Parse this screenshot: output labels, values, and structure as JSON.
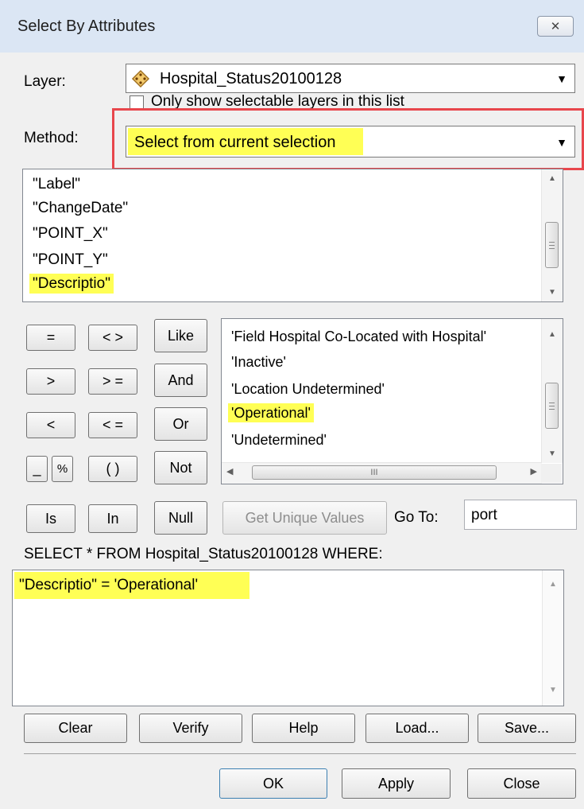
{
  "window": {
    "title": "Select By Attributes",
    "close_glyph": "✕"
  },
  "layer": {
    "label": "Layer:",
    "value": "Hospital_Status20100128",
    "checkbox_label": "Only show selectable layers in this list",
    "checked": false
  },
  "method": {
    "label": "Method:",
    "value": "Select from current selection"
  },
  "fields": [
    "\"Label\"",
    "\"ChangeDate\"",
    "\"POINT_X\"",
    "\"POINT_Y\"",
    "\"Descriptio\""
  ],
  "selected_field": "\"Descriptio\"",
  "operators": {
    "eq": "=",
    "neq": "< >",
    "like": "Like",
    "gt": ">",
    "gte": "> =",
    "and": "And",
    "lt": "<",
    "lte": "< =",
    "or": "Or",
    "underscore": "_",
    "percent": "%",
    "parens": "( )",
    "not": "Not",
    "is": "Is",
    "in": "In",
    "null": "Null"
  },
  "values": [
    "'Field Hospital Co-Located with Hospital'",
    "'Inactive'",
    "'Location Undetermined'",
    "'Operational'",
    "'Undetermined'"
  ],
  "selected_value": "'Operational'",
  "hscroll_grip": "III",
  "get_unique_values": "Get Unique Values",
  "goto": {
    "label": "Go To:",
    "value": "port"
  },
  "select_statement": "SELECT * FROM Hospital_Status20100128 WHERE:",
  "expression": "\"Descriptio\" = 'Operational'",
  "actions": {
    "clear": "Clear",
    "verify": "Verify",
    "help": "Help",
    "load": "Load...",
    "save": "Save..."
  },
  "footer": {
    "ok": "OK",
    "apply": "Apply",
    "close": "Close"
  },
  "colors": {
    "highlight": "#ffff55",
    "annotation_border": "#e8464c",
    "titlebar": "#dbe6f4"
  },
  "icons": {
    "layer": "layer-diamond-icon",
    "dropdown": "chevron-down-icon"
  }
}
